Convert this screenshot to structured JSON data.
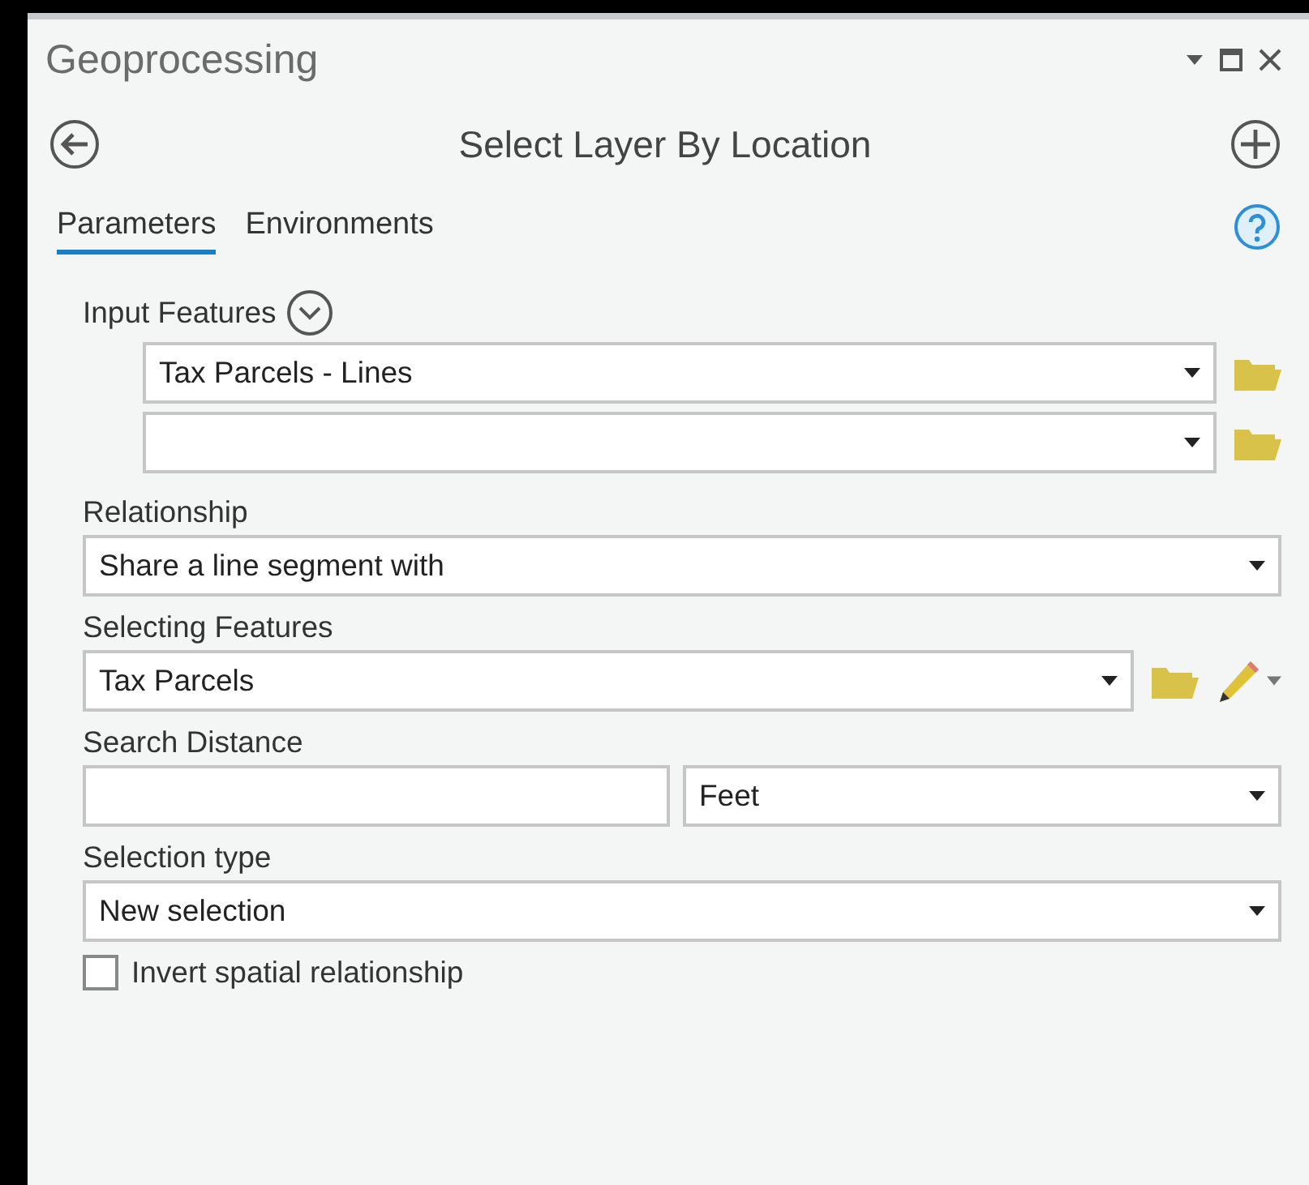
{
  "window": {
    "title": "Geoprocessing"
  },
  "tool": {
    "title": "Select Layer By Location"
  },
  "tabs": [
    {
      "label": "Parameters",
      "selected": true
    },
    {
      "label": "Environments",
      "selected": false
    }
  ],
  "parameters": [
    {
      "kind": "multi",
      "label": "Input Features",
      "rows": [
        {
          "value": "Tax Parcels - Lines"
        },
        {}
      ]
    },
    {
      "kind": "combo",
      "label": "Relationship",
      "value": "Share a line segment with"
    },
    {
      "kind": "combo",
      "label": "Selecting Features",
      "value": "Tax Parcels",
      "browse": true,
      "sketch": true
    },
    {
      "kind": "distance",
      "label": "Search Distance",
      "unit": "Feet"
    },
    {
      "kind": "combo",
      "label": "Selection type",
      "value": "New selection"
    },
    {
      "kind": "checkbox",
      "label": "Invert spatial relationship",
      "checked": false
    }
  ]
}
